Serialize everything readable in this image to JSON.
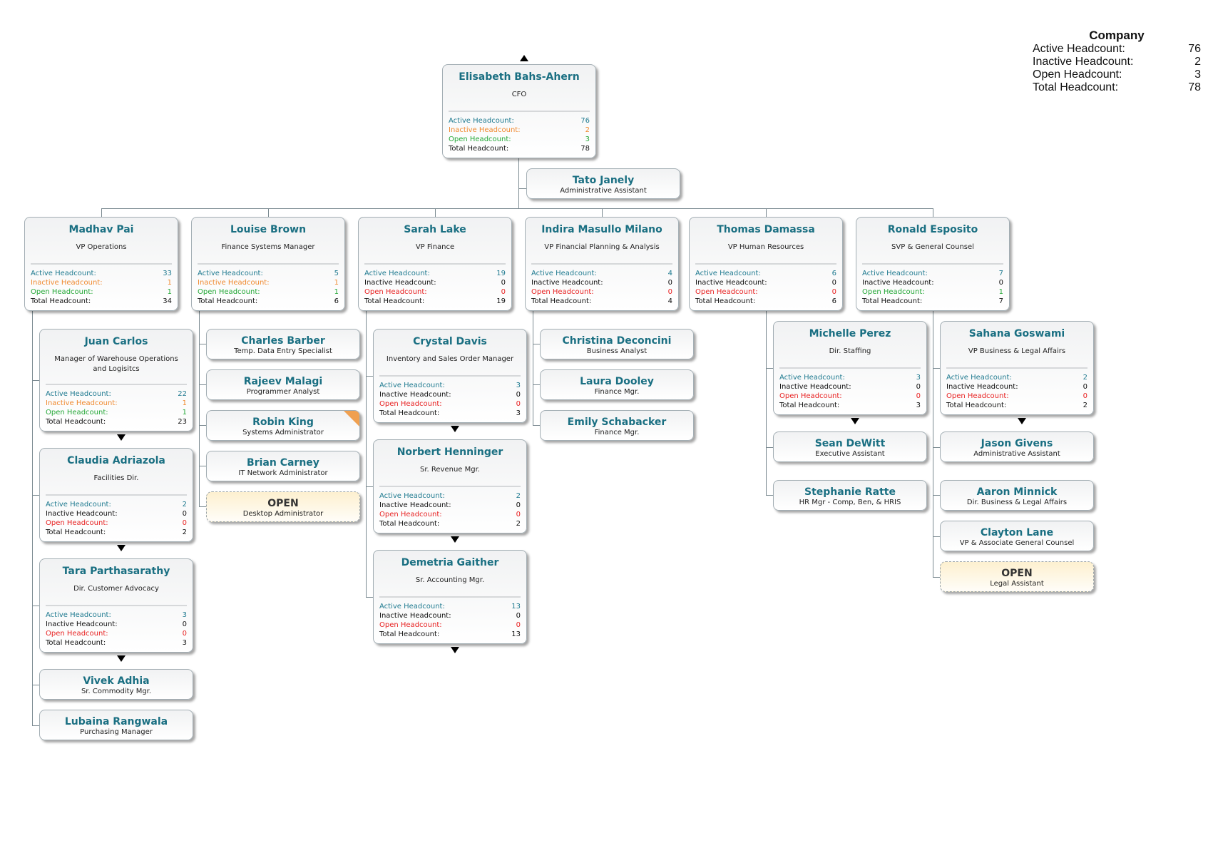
{
  "summary": {
    "title": "Company",
    "rows": [
      {
        "label": "Active Headcount:",
        "value": "76"
      },
      {
        "label": "Inactive Headcount:",
        "value": "2"
      },
      {
        "label": "Open Headcount:",
        "value": "3"
      },
      {
        "label": "Total Headcount:",
        "value": "78"
      }
    ]
  },
  "stat_labels": {
    "active": "Active Headcount:",
    "inactive": "Inactive Headcount:",
    "open": "Open Headcount:",
    "total": "Total Headcount:"
  },
  "colors": {
    "name": "#1a6f82",
    "active": "#1f7a90",
    "inactive": "#f08a30",
    "open_positive": "#25a838",
    "open_zero": "#e82222",
    "flag": "#f0a050"
  },
  "nodes": [
    {
      "id": "ceo",
      "name": "Elisabeth Bahs-Ahern",
      "title": "CFO",
      "stats": {
        "active": "76",
        "inactive": "2",
        "open": "3",
        "total": "78"
      },
      "expand_up": true
    },
    {
      "id": "tato",
      "name": "Tato Janely",
      "title": "Administrative Assistant"
    },
    {
      "id": "madhav",
      "name": "Madhav Pai",
      "title": "VP Operations",
      "stats": {
        "active": "33",
        "inactive": "1",
        "open": "1",
        "total": "34"
      }
    },
    {
      "id": "louise",
      "name": "Louise Brown",
      "title": "Finance Systems Manager",
      "stats": {
        "active": "5",
        "inactive": "1",
        "open": "1",
        "total": "6"
      }
    },
    {
      "id": "sarah",
      "name": "Sarah Lake",
      "title": "VP Finance",
      "stats": {
        "active": "19",
        "inactive": "0",
        "open": "0",
        "total": "19"
      }
    },
    {
      "id": "indira",
      "name": "Indira Masullo Milano",
      "title": "VP Financial Planning & Analysis",
      "stats": {
        "active": "4",
        "inactive": "0",
        "open": "0",
        "total": "4"
      }
    },
    {
      "id": "thomas",
      "name": "Thomas Damassa",
      "title": "VP Human Resources",
      "stats": {
        "active": "6",
        "inactive": "0",
        "open": "0",
        "total": "6"
      }
    },
    {
      "id": "ronald",
      "name": "Ronald Esposito",
      "title": "SVP & General Counsel",
      "stats": {
        "active": "7",
        "inactive": "0",
        "open": "1",
        "total": "7"
      }
    },
    {
      "id": "juan",
      "name": "Juan Carlos",
      "title": "Manager of Warehouse Operations and Logisitcs",
      "stats": {
        "active": "22",
        "inactive": "1",
        "open": "1",
        "total": "23"
      },
      "expand_down": true
    },
    {
      "id": "claudia",
      "name": "Claudia Adriazola",
      "title": "Facilities Dir.",
      "stats": {
        "active": "2",
        "inactive": "0",
        "open": "0",
        "total": "2"
      },
      "expand_down": true
    },
    {
      "id": "tara",
      "name": "Tara Parthasarathy",
      "title": "Dir. Customer Advocacy",
      "stats": {
        "active": "3",
        "inactive": "0",
        "open": "0",
        "total": "3"
      },
      "expand_down": true
    },
    {
      "id": "vivek",
      "name": "Vivek Adhia",
      "title": "Sr. Commodity Mgr."
    },
    {
      "id": "lubaina",
      "name": "Lubaina Rangwala",
      "title": "Purchasing Manager"
    },
    {
      "id": "charles",
      "name": "Charles Barber",
      "title": "Temp. Data Entry Specialist"
    },
    {
      "id": "rajeev",
      "name": "Rajeev Malagi",
      "title": "Programmer Analyst"
    },
    {
      "id": "robin",
      "name": "Robin King",
      "title": "Systems Administrator",
      "flagged": true
    },
    {
      "id": "brian",
      "name": "Brian Carney",
      "title": "IT Network Administrator"
    },
    {
      "id": "open1",
      "name": "OPEN",
      "title": "Desktop Administrator",
      "open": true
    },
    {
      "id": "crystal",
      "name": "Crystal Davis",
      "title": "Inventory and Sales Order Manager",
      "stats": {
        "active": "3",
        "inactive": "0",
        "open": "0",
        "total": "3"
      },
      "expand_down": true
    },
    {
      "id": "norbert",
      "name": "Norbert Henninger",
      "title": "Sr. Revenue Mgr.",
      "stats": {
        "active": "2",
        "inactive": "0",
        "open": "0",
        "total": "2"
      },
      "expand_down": true
    },
    {
      "id": "demetria",
      "name": "Demetria Gaither",
      "title": "Sr. Accounting Mgr.",
      "stats": {
        "active": "13",
        "inactive": "0",
        "open": "0",
        "total": "13"
      },
      "expand_down": true
    },
    {
      "id": "christina",
      "name": "Christina Deconcini",
      "title": "Business Analyst"
    },
    {
      "id": "laura",
      "name": "Laura Dooley",
      "title": "Finance Mgr."
    },
    {
      "id": "emily",
      "name": "Emily Schabacker",
      "title": "Finance Mgr."
    },
    {
      "id": "michelle",
      "name": "Michelle Perez",
      "title": "Dir. Staffing",
      "stats": {
        "active": "3",
        "inactive": "0",
        "open": "0",
        "total": "3"
      },
      "expand_down": true
    },
    {
      "id": "sean",
      "name": "Sean DeWitt",
      "title": "Executive Assistant"
    },
    {
      "id": "stephanie",
      "name": "Stephanie Ratte",
      "title": "HR Mgr - Comp, Ben, & HRIS"
    },
    {
      "id": "sahana",
      "name": "Sahana Goswami",
      "title": "VP Business & Legal Affairs",
      "stats": {
        "active": "2",
        "inactive": "0",
        "open": "0",
        "total": "2"
      },
      "expand_down": true
    },
    {
      "id": "jason",
      "name": "Jason Givens",
      "title": "Administrative Assistant"
    },
    {
      "id": "aaron",
      "name": "Aaron Minnick",
      "title": "Dir. Business & Legal Affairs"
    },
    {
      "id": "clayton",
      "name": "Clayton Lane",
      "title": "VP & Associate General Counsel"
    },
    {
      "id": "open2",
      "name": "OPEN",
      "title": "Legal Assistant",
      "open": true
    }
  ]
}
